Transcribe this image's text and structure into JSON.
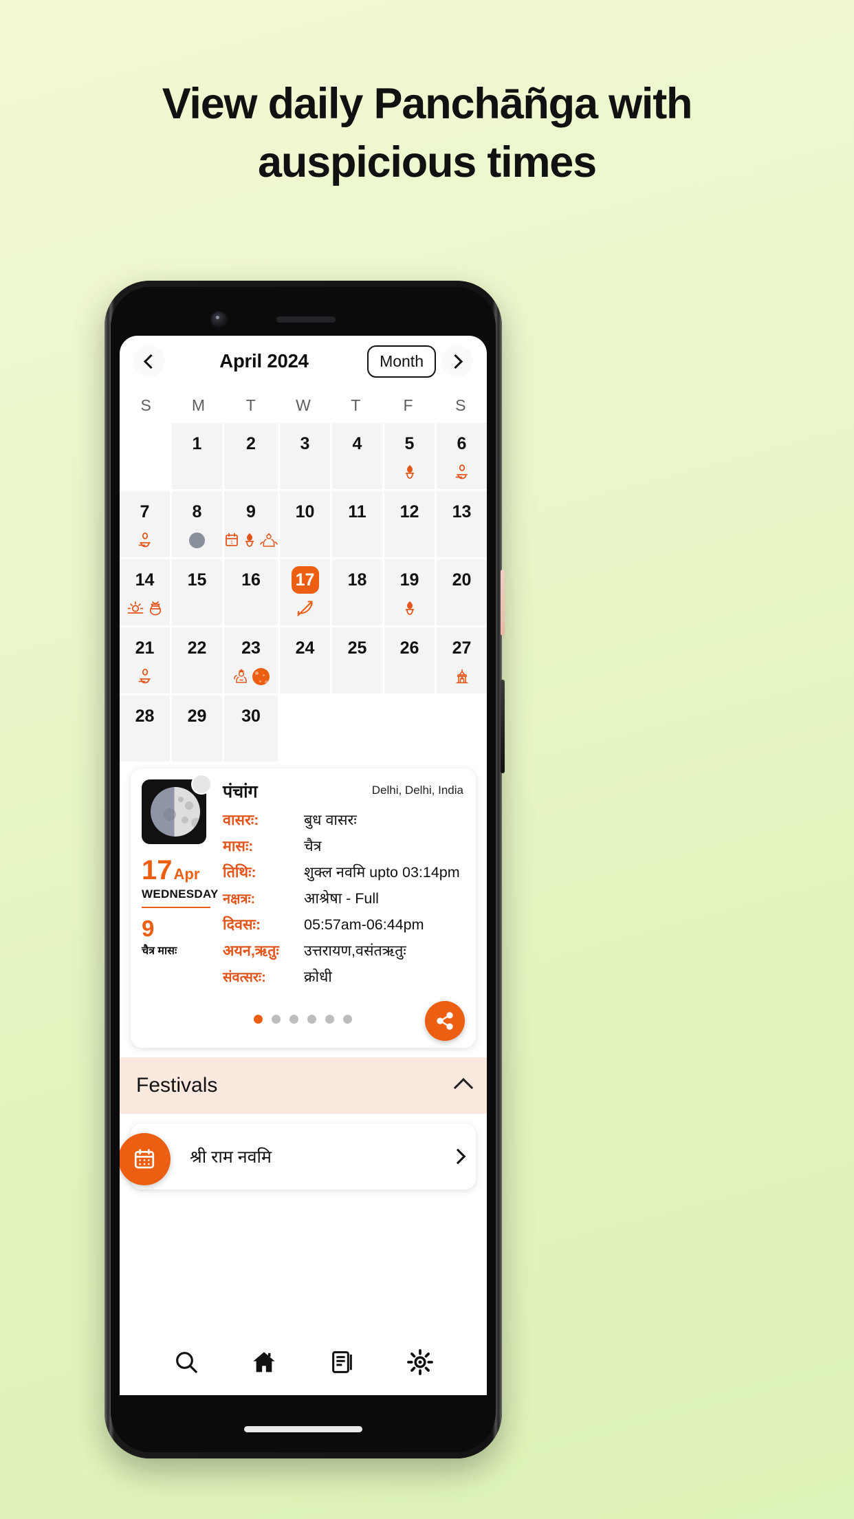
{
  "headline": {
    "line1": "View daily Panchāñga with",
    "line2": "auspicious times"
  },
  "colors": {
    "accent": "#ec5f13",
    "accent_text": "#e2561c",
    "festival_header_bg": "#fbe8de",
    "page_bg": "#eaf7c9",
    "cell_bg": "#f4f4f4"
  },
  "calendar": {
    "prev_icon": "chevron-left-icon",
    "next_icon": "chevron-right-icon",
    "title": "April 2024",
    "view_button": "Month",
    "weekdays": [
      "S",
      "M",
      "T",
      "W",
      "T",
      "F",
      "S"
    ],
    "leading_blanks": 1,
    "days": [
      {
        "n": "1",
        "icons": []
      },
      {
        "n": "2",
        "icons": []
      },
      {
        "n": "3",
        "icons": []
      },
      {
        "n": "4",
        "icons": []
      },
      {
        "n": "5",
        "icons": [
          "kalash-icon"
        ]
      },
      {
        "n": "6",
        "icons": [
          "shivling-icon"
        ]
      },
      {
        "n": "7",
        "icons": [
          "shivling-icon"
        ]
      },
      {
        "n": "8",
        "icons": [
          "new-moon-icon"
        ]
      },
      {
        "n": "9",
        "icons": [
          "calendar-icon",
          "kalash-icon",
          "goddess-icon"
        ]
      },
      {
        "n": "10",
        "icons": []
      },
      {
        "n": "11",
        "icons": []
      },
      {
        "n": "12",
        "icons": []
      },
      {
        "n": "13",
        "icons": []
      },
      {
        "n": "14",
        "icons": [
          "sun-icon",
          "pot-icon"
        ]
      },
      {
        "n": "15",
        "icons": []
      },
      {
        "n": "16",
        "icons": []
      },
      {
        "n": "17",
        "icons": [
          "bow-arrow-icon"
        ],
        "today": true
      },
      {
        "n": "18",
        "icons": []
      },
      {
        "n": "19",
        "icons": [
          "kalash-icon"
        ]
      },
      {
        "n": "20",
        "icons": []
      },
      {
        "n": "21",
        "icons": [
          "shivling-icon"
        ]
      },
      {
        "n": "22",
        "icons": []
      },
      {
        "n": "23",
        "icons": [
          "hanuman-icon",
          "full-moon-icon"
        ]
      },
      {
        "n": "24",
        "icons": []
      },
      {
        "n": "25",
        "icons": []
      },
      {
        "n": "26",
        "icons": []
      },
      {
        "n": "27",
        "icons": [
          "temple-icon"
        ]
      },
      {
        "n": "28",
        "icons": []
      },
      {
        "n": "29",
        "icons": []
      },
      {
        "n": "30",
        "icons": []
      }
    ]
  },
  "panchang": {
    "title": "पंचांग",
    "location": "Delhi, Delhi, India",
    "moon_icon": "waning-moon-icon",
    "date_number": "17",
    "date_month": "Apr",
    "date_weekday": "WEDNESDAY",
    "masa_number": "9",
    "masa_label": "चैत्र मासः",
    "rows": [
      {
        "key": "वासरः:",
        "value": "बुध वासरः"
      },
      {
        "key": "मासः:",
        "value": "चैत्र"
      },
      {
        "key": "तिथिः:",
        "value": "शुक्ल नवमि upto 03:14pm"
      },
      {
        "key": "नक्षत्रः:",
        "value": "आश्रेषा - Full"
      },
      {
        "key": "दिवसः:",
        "value": "05:57am-06:44pm"
      },
      {
        "key": "अयन,ऋतुः",
        "value": "उत्तरायण,वसंतऋतुः"
      },
      {
        "key": "संवत्सरः:",
        "value": "क्रोधी"
      }
    ],
    "dots_total": 6,
    "dots_active_index": 0,
    "share_icon": "share-icon"
  },
  "festivals": {
    "header": "Festivals",
    "collapse_icon": "chevron-up-icon",
    "items": [
      {
        "name": "श्री राम नवमि",
        "icon": "calendar-badge-icon",
        "arrow": "chevron-right-icon"
      }
    ]
  },
  "bottom_nav": [
    {
      "icon": "search-icon",
      "name": "nav-search"
    },
    {
      "icon": "home-icon",
      "name": "nav-home"
    },
    {
      "icon": "articles-icon",
      "name": "nav-articles"
    },
    {
      "icon": "settings-icon",
      "name": "nav-settings"
    }
  ]
}
